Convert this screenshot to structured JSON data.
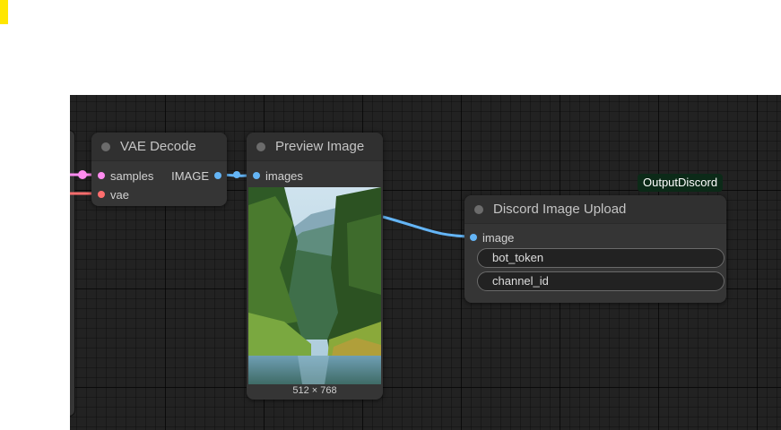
{
  "nodes": {
    "vae_decode": {
      "title": "VAE Decode",
      "inputs": [
        "samples",
        "vae"
      ],
      "output": "IMAGE"
    },
    "preview_image": {
      "title": "Preview Image",
      "input": "images",
      "image_size": "512 × 768"
    },
    "discord_upload": {
      "title": "Discord Image Upload",
      "badge": "OutputDiscord",
      "input": "image",
      "widgets": [
        "bot_token",
        "channel_id"
      ]
    }
  },
  "colors": {
    "canvas": "#222222",
    "node_body": "#353535",
    "samples_socket": "#ff8cf0",
    "vae_socket": "#ff6e6e",
    "image_socket": "#64b5f6",
    "badge_bg": "#0c2a18",
    "marker": "#ffe600"
  }
}
